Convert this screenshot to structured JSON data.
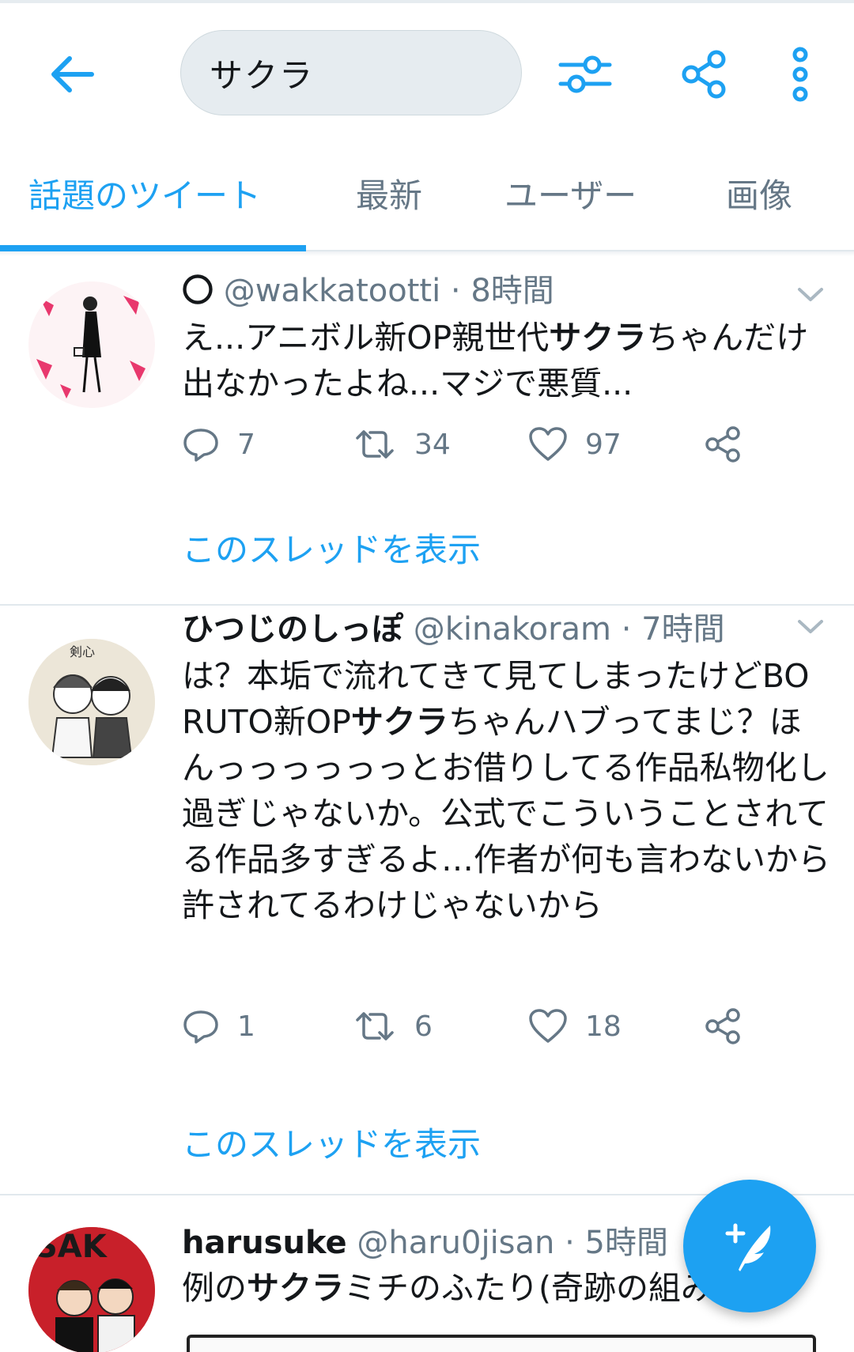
{
  "header": {
    "search_value": "サクラ"
  },
  "tabs": [
    {
      "label": "話題のツイート",
      "active": true
    },
    {
      "label": "最新",
      "active": false
    },
    {
      "label": "ユーザー",
      "active": false
    },
    {
      "label": "画像",
      "active": false
    }
  ],
  "tweets": [
    {
      "name": "〇",
      "handle": "@wakkatootti",
      "time": "8時間",
      "text_segments": [
        {
          "text": "え...アニボル新OP親世代",
          "bold": false
        },
        {
          "text": "サクラ",
          "bold": true
        },
        {
          "text": "ちゃんだけ出なかったよね...マジで悪質...",
          "bold": false
        }
      ],
      "replies": "7",
      "retweets": "34",
      "likes": "97",
      "thread_link": "このスレッドを表示"
    },
    {
      "name": "ひつじのしっぽ",
      "handle": "@kinakoram",
      "time": "7時間",
      "text_segments": [
        {
          "text": "は？本垢で流れてきて見てしまったけどBORUTO新OP",
          "bold": false
        },
        {
          "text": "サクラ",
          "bold": true
        },
        {
          "text": "ちゃんハブってまじ？ほんっっっっっっとお借りしてる作品私物化し過ぎじゃないか。公式でこういうことされてる作品多すぎるよ…作者が何も言わないから許されてるわけじゃないから",
          "bold": false
        }
      ],
      "replies": "1",
      "retweets": "6",
      "likes": "18",
      "thread_link": "このスレッドを表示"
    },
    {
      "name": "harusuke",
      "handle": "@haru0jisan",
      "time": "5時間",
      "text_segments": [
        {
          "text": "例の",
          "bold": false
        },
        {
          "text": "サクラ",
          "bold": true
        },
        {
          "text": "ミチのふたり(奇跡の組み合)",
          "bold": false
        }
      ]
    }
  ],
  "colors": {
    "accent": "#1da1f2",
    "muted": "#657786",
    "divider": "#e1e8ed"
  },
  "icons": [
    "arrow-left-icon",
    "filter-sliders-icon",
    "share-icon",
    "more-vertical-icon",
    "chevron-down-icon",
    "reply-icon",
    "retweet-icon",
    "heart-icon",
    "compose-icon"
  ]
}
